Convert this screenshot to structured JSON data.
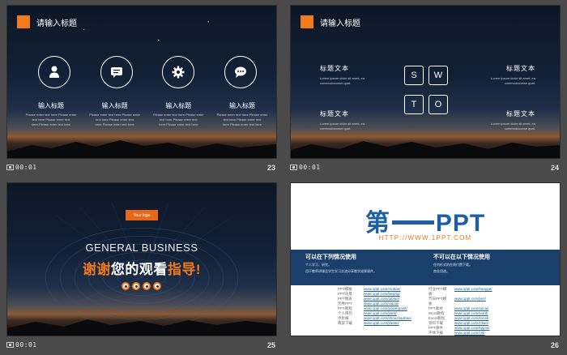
{
  "slides": [
    {
      "number": "23",
      "time": "00:01",
      "title": "请输入标题",
      "icons": [
        "user-icon",
        "chat-bubble-icon",
        "gear-icon",
        "speech-icon"
      ],
      "columns": [
        {
          "heading": "输入标题",
          "body": "Please enter text here.Please enter text here.Please enter text here.Please enter text here"
        },
        {
          "heading": "输入标题",
          "body": "Please enter text here.Please enter text here.Please enter text here.Please enter text here"
        },
        {
          "heading": "输入标题",
          "body": "Please enter text here.Please enter text here.Please enter text here.Please enter text here"
        },
        {
          "heading": "输入标题",
          "body": "Please enter text here.Please enter text here.Please enter text here.Please enter text here"
        }
      ]
    },
    {
      "number": "24",
      "time": "00:01",
      "title": "请输入标题",
      "swot": [
        "S",
        "W",
        "T",
        "O"
      ],
      "blocks": [
        {
          "heading": "标题文本",
          "body": "Lorem ipsum dolor sit amet, ea commodoconse quat."
        },
        {
          "heading": "标题文本",
          "body": "Lorem ipsum dolor sit amet, ea commodoconse quat."
        },
        {
          "heading": "标题文本",
          "body": "Lorem ipsum dolor sit amet, ea commodoconse quat."
        },
        {
          "heading": "标题文本",
          "body": "Lorem ipsum dolor sit amet, ea commodoconse quat."
        }
      ]
    },
    {
      "number": "25",
      "time": "00:01",
      "logo_label": "Your logo",
      "heading": "GENERAL BUSINESS",
      "thanks_a": "谢谢",
      "thanks_b": "您的观看",
      "thanks_c": "指导!"
    },
    {
      "number": "26",
      "time": "",
      "brand_a": "第",
      "brand_b": "PPT",
      "url": "HTTP://WWW.1PPT.COM",
      "left_heading": "可以在下列情况使用",
      "left_items": [
        "个人学习、研究。",
        "用于教师讲课及学生学习交流分享教学成果课件。"
      ],
      "right_heading": "不可以在以下情况使用",
      "right_items": [
        "任何形式的在线付费下载。",
        "商业用途。"
      ],
      "links_left": [
        {
          "key": "PPT模板",
          "url": "www.1ppt.com/moban/"
        },
        {
          "key": "PPT背景",
          "url": "www.1ppt.com/beijing/"
        },
        {
          "key": "PPT图表",
          "url": "www.1ppt.com/tubiao/"
        },
        {
          "key": "优秀PPT",
          "url": "www.1ppt.com/xiazai/"
        },
        {
          "key": "PPT教程",
          "url": "www.1ppt.com/powerpoint/"
        },
        {
          "key": "个人简历",
          "url": "www.1ppt.com/jianli/"
        },
        {
          "key": "手抄报",
          "url": "www.1ppt.com/shouchaobao/"
        },
        {
          "key": "教案下载",
          "url": "www.1ppt.com/jiaoan/"
        }
      ],
      "links_right": [
        {
          "key": "行业PPT模板",
          "url": "www.1ppt.com/hangye/"
        },
        {
          "key": "节日PPT模板",
          "url": "www.1ppt.com/jieri/"
        },
        {
          "key": "PPT素材",
          "url": "www.1ppt.com/sucai/"
        },
        {
          "key": "Word教程",
          "url": "www.1ppt.com/word/"
        },
        {
          "key": "Excel教程",
          "url": "www.1ppt.com/excel/"
        },
        {
          "key": "资料下载",
          "url": "www.1ppt.com/ziliao/"
        },
        {
          "key": "PPT课件",
          "url": "www.1ppt.com/kejian/"
        },
        {
          "key": "字体下载",
          "url": "www.1ppt.com/ziti/"
        }
      ]
    }
  ],
  "colors": {
    "accent": "#f07a1c",
    "brand_blue": "#1d5fa5",
    "navy_bar": "#1b3f6b",
    "sorter_bg": "#4a4a4a"
  }
}
